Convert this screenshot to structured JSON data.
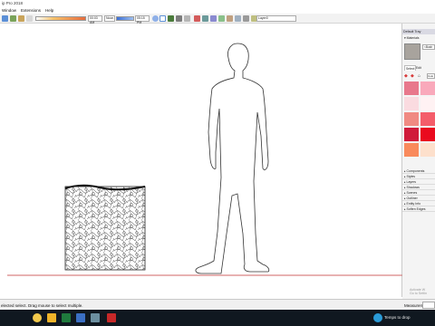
{
  "app": {
    "title": "ip Pro 2018"
  },
  "menu": {
    "items": [
      "Window",
      "Extensions",
      "Help"
    ]
  },
  "toolbar": {
    "field_left": "00:03 AM",
    "field_noon": "Noon",
    "field_right": "05:15 PM",
    "layer_value": "Layer0"
  },
  "tray": {
    "title": "Default Tray",
    "section": "Materials",
    "material_name": "<Bush",
    "tabs": {
      "select": "Select",
      "edit": "Edit"
    },
    "collection_value": "Colo",
    "swatch_colors": [
      "#e8788c",
      "#f9a9bb",
      "#fadbe0",
      "#fff2f3",
      "#f08a82",
      "#f45d6a",
      "#d01a3a",
      "#ea0a1e",
      "#f98a5c",
      "#fde0cc",
      "#f59b71",
      "#fbd1b3"
    ],
    "panels": [
      "Components",
      "Styles",
      "Layers",
      "Shadows",
      "Scenes",
      "Outliner",
      "Entity Info",
      "Soften Edges"
    ]
  },
  "status": {
    "text": "elected select. Drag mouse to select multiple.",
    "measurements_label": "Measurem"
  },
  "taskbar": {
    "time_text": "Temps to drop"
  },
  "watermark": {
    "line1": "Activate W",
    "line2": "Go to Settin"
  }
}
